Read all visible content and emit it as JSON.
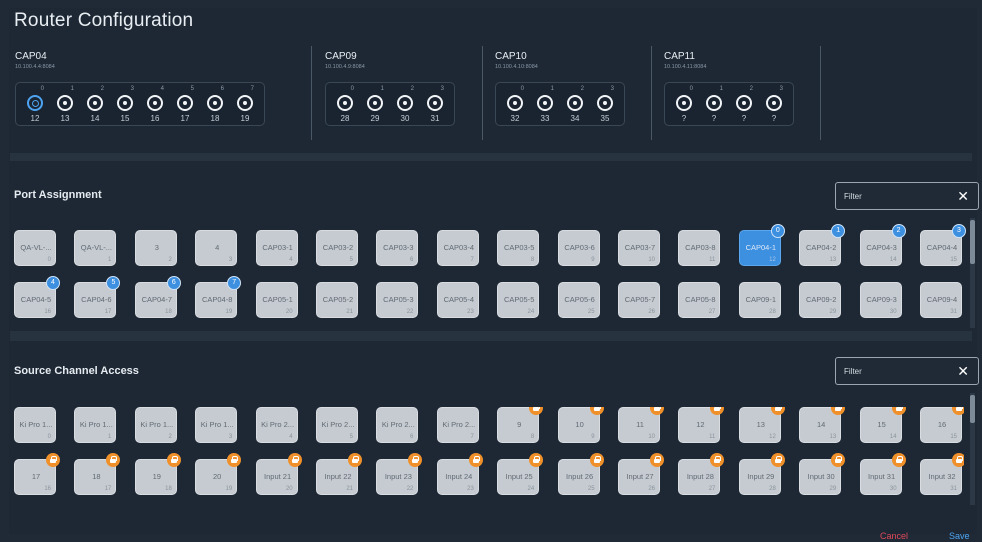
{
  "title": "Router Configuration",
  "devices": [
    {
      "name": "CAP04",
      "ip": "10.100.4.4:8084",
      "ports": [
        {
          "idx": "0",
          "num": "12"
        },
        {
          "idx": "1",
          "num": "13"
        },
        {
          "idx": "2",
          "num": "14"
        },
        {
          "idx": "3",
          "num": "15"
        },
        {
          "idx": "4",
          "num": "16"
        },
        {
          "idx": "5",
          "num": "17"
        },
        {
          "idx": "6",
          "num": "18"
        },
        {
          "idx": "7",
          "num": "19"
        }
      ]
    },
    {
      "name": "CAP09",
      "ip": "10.100.4.9:8084",
      "ports": [
        {
          "idx": "0",
          "num": "28"
        },
        {
          "idx": "1",
          "num": "29"
        },
        {
          "idx": "2",
          "num": "30"
        },
        {
          "idx": "3",
          "num": "31"
        }
      ]
    },
    {
      "name": "CAP10",
      "ip": "10.100.4.10:8084",
      "ports": [
        {
          "idx": "0",
          "num": "32"
        },
        {
          "idx": "1",
          "num": "33"
        },
        {
          "idx": "2",
          "num": "34"
        },
        {
          "idx": "3",
          "num": "35"
        }
      ]
    },
    {
      "name": "CAP11",
      "ip": "10.100.4.11:8084",
      "ports": [
        {
          "idx": "0",
          "num": "?"
        },
        {
          "idx": "1",
          "num": "?"
        },
        {
          "idx": "2",
          "num": "?"
        },
        {
          "idx": "3",
          "num": "?"
        }
      ]
    }
  ],
  "port_assignment": {
    "title": "Port Assignment",
    "filter_label": "Filter",
    "close_glyph": "✕",
    "row1": [
      {
        "label": "QA-VL-...",
        "num": "0"
      },
      {
        "label": "QA-VL-...",
        "num": "1"
      },
      {
        "label": "3",
        "num": "2"
      },
      {
        "label": "4",
        "num": "3"
      },
      {
        "label": "CAP03-1",
        "num": "4"
      },
      {
        "label": "CAP03-2",
        "num": "5"
      },
      {
        "label": "CAP03-3",
        "num": "6"
      },
      {
        "label": "CAP03-4",
        "num": "7"
      },
      {
        "label": "CAP03-5",
        "num": "8"
      },
      {
        "label": "CAP03-6",
        "num": "9"
      },
      {
        "label": "CAP03-7",
        "num": "10"
      },
      {
        "label": "CAP03-8",
        "num": "11"
      },
      {
        "label": "CAP04-1",
        "num": "12",
        "badge": "0",
        "selected": true
      },
      {
        "label": "CAP04-2",
        "num": "13",
        "badge": "1"
      },
      {
        "label": "CAP04-3",
        "num": "14",
        "badge": "2"
      },
      {
        "label": "CAP04-4",
        "num": "15",
        "badge": "3"
      }
    ],
    "row2": [
      {
        "label": "CAP04-5",
        "num": "16",
        "badge": "4"
      },
      {
        "label": "CAP04-6",
        "num": "17",
        "badge": "5"
      },
      {
        "label": "CAP04-7",
        "num": "18",
        "badge": "6"
      },
      {
        "label": "CAP04-8",
        "num": "19",
        "badge": "7"
      },
      {
        "label": "CAP05-1",
        "num": "20"
      },
      {
        "label": "CAP05-2",
        "num": "21"
      },
      {
        "label": "CAP05-3",
        "num": "22"
      },
      {
        "label": "CAP05-4",
        "num": "23"
      },
      {
        "label": "CAP05-5",
        "num": "24"
      },
      {
        "label": "CAP05-6",
        "num": "25"
      },
      {
        "label": "CAP05-7",
        "num": "26"
      },
      {
        "label": "CAP05-8",
        "num": "27"
      },
      {
        "label": "CAP09-1",
        "num": "28"
      },
      {
        "label": "CAP09-2",
        "num": "29"
      },
      {
        "label": "CAP09-3",
        "num": "30"
      },
      {
        "label": "CAP09-4",
        "num": "31"
      }
    ]
  },
  "source_channel": {
    "title": "Source Channel Access",
    "filter_label": "Filter",
    "close_glyph": "✕",
    "row1": [
      {
        "label": "Ki Pro 1...",
        "num": "0"
      },
      {
        "label": "Ki Pro 1...",
        "num": "1"
      },
      {
        "label": "Ki Pro 1...",
        "num": "2"
      },
      {
        "label": "Ki Pro 1...",
        "num": "3"
      },
      {
        "label": "Ki Pro 2...",
        "num": "4"
      },
      {
        "label": "Ki Pro 2...",
        "num": "5"
      },
      {
        "label": "Ki Pro 2...",
        "num": "6"
      },
      {
        "label": "Ki Pro 2...",
        "num": "7"
      },
      {
        "label": "9",
        "num": "8",
        "lock": true
      },
      {
        "label": "10",
        "num": "9",
        "lock": true
      },
      {
        "label": "11",
        "num": "10",
        "lock": true
      },
      {
        "label": "12",
        "num": "11",
        "lock": true
      },
      {
        "label": "13",
        "num": "12",
        "lock": true
      },
      {
        "label": "14",
        "num": "13",
        "lock": true
      },
      {
        "label": "15",
        "num": "14",
        "lock": true
      },
      {
        "label": "16",
        "num": "15",
        "lock": true
      }
    ],
    "row2": [
      {
        "label": "17",
        "num": "16",
        "lock": true
      },
      {
        "label": "18",
        "num": "17",
        "lock": true
      },
      {
        "label": "19",
        "num": "18",
        "lock": true
      },
      {
        "label": "20",
        "num": "19",
        "lock": true
      },
      {
        "label": "Input 21",
        "num": "20",
        "lock": true
      },
      {
        "label": "Input 22",
        "num": "21",
        "lock": true
      },
      {
        "label": "Input 23",
        "num": "22",
        "lock": true
      },
      {
        "label": "Input 24",
        "num": "23",
        "lock": true
      },
      {
        "label": "Input 25",
        "num": "24",
        "lock": true
      },
      {
        "label": "Input 26",
        "num": "25",
        "lock": true
      },
      {
        "label": "Input 27",
        "num": "26",
        "lock": true
      },
      {
        "label": "Input 28",
        "num": "27",
        "lock": true
      },
      {
        "label": "Input 29",
        "num": "28",
        "lock": true
      },
      {
        "label": "Input 30",
        "num": "29",
        "lock": true
      },
      {
        "label": "Input 31",
        "num": "30",
        "lock": true
      },
      {
        "label": "Input 32",
        "num": "31",
        "lock": true
      }
    ]
  },
  "footer": {
    "cancel_label": "Cancel",
    "save_label": "Save"
  },
  "colors": {
    "accent": "#3d8fe0",
    "lock": "#f0902a",
    "cancel": "#e0475a",
    "background": "#1d2834"
  }
}
